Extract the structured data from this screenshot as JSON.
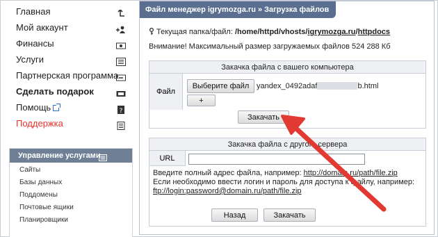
{
  "sidebar": {
    "items": [
      {
        "label": "Главная",
        "icon": "home-arrow-icon"
      },
      {
        "label": "Мой аккаунт",
        "icon": "user-add-icon"
      },
      {
        "label": "Финансы",
        "icon": "money-icon"
      },
      {
        "label": "Услуги",
        "icon": "list-icon"
      },
      {
        "label": "Партнерская программа",
        "icon": "partner-money-icon"
      },
      {
        "label": "Сделать подарок",
        "icon": "gift-icon"
      },
      {
        "label": "Помощь",
        "icon": "help-icon"
      },
      {
        "label": "Поддержка",
        "icon": "support-icon"
      }
    ],
    "services": {
      "title": "Управление услугами",
      "items": [
        "Сайты",
        "Базы данных",
        "Поддомены",
        "Почтовые ящики",
        "Планировщики"
      ]
    }
  },
  "main": {
    "title": "Файл менеджер igrymozga.ru » Загрузка файлов",
    "path_prefix": "Текущая папка/файл:",
    "path_root": "/home/httpd/vhosts/",
    "path_site": "igrymozga.ru",
    "path_sep": "/",
    "path_dir": "httpdocs",
    "warning": "Внимание! Максимальный размер загружаемых файлов 524 288 Кб",
    "local_upload": {
      "header": "Закачка файла с вашего компьютера",
      "file_label": "Файл",
      "choose_label": "Выберите файл",
      "file_name_start": "yandex_0492adaf",
      "file_name_end": "b.html",
      "add_label": "+",
      "submit_label": "Закачать"
    },
    "remote_upload": {
      "header": "Закачка файла с другого сервера",
      "url_label": "URL",
      "url_value": "",
      "help_line1_text": "Введите полный адрес файла, например: ",
      "help_line1_link": "http://domain.ru/path/file.zip",
      "help_line2": "Если необходимо ввести логин и пароль для доступа к файлу, например:",
      "help_line3": "ftp://login:password@domain.ru/path/file.zip",
      "back_label": "Назад",
      "submit_label": "Закачать"
    }
  },
  "colors": {
    "title_bar": "#5a6e8f",
    "services_header": "#6f7f96",
    "support_red": "#e8322a",
    "annotation_arrow": "#e23a32"
  }
}
